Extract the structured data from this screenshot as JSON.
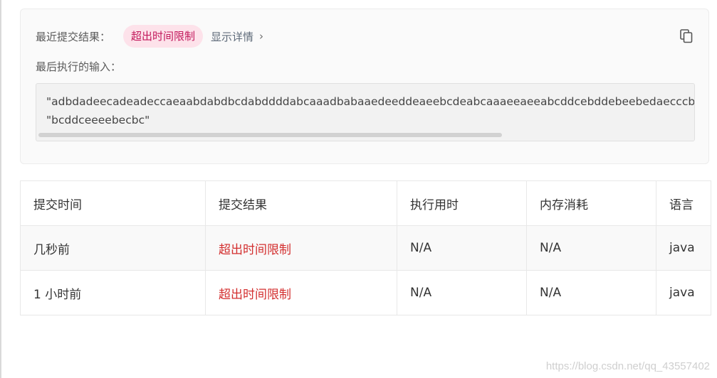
{
  "result": {
    "recent_label": "最近提交结果：",
    "status": "超出时间限制",
    "details_link": "显示详情",
    "last_input_label": "最后执行的输入：",
    "input_lines": [
      "\"adbdadeecadeadeccaeaabdabdbcdabddddabcaaadbabaaedeeddeaeebcdeabcaaaeeaeeabcddcebddebeebedaecccbdcbcedb",
      "\"bcddceeeebecbc\""
    ]
  },
  "table": {
    "headers": [
      "提交时间",
      "提交结果",
      "执行用时",
      "内存消耗",
      "语言"
    ],
    "rows": [
      {
        "time": "几秒前",
        "result": "超出时间限制",
        "runtime": "N/A",
        "memory": "N/A",
        "language": "java"
      },
      {
        "time": "1 小时前",
        "result": "超出时间限制",
        "runtime": "N/A",
        "memory": "N/A",
        "language": "java"
      }
    ]
  },
  "watermark": "https://blog.csdn.net/qq_43557402",
  "colors": {
    "status_pill_bg": "#fde2ea",
    "status_pill_text": "#c2185b",
    "status_red": "#d32f2f"
  },
  "icons": {
    "copy": "copy-icon",
    "chevron": "chevron-right-icon"
  }
}
